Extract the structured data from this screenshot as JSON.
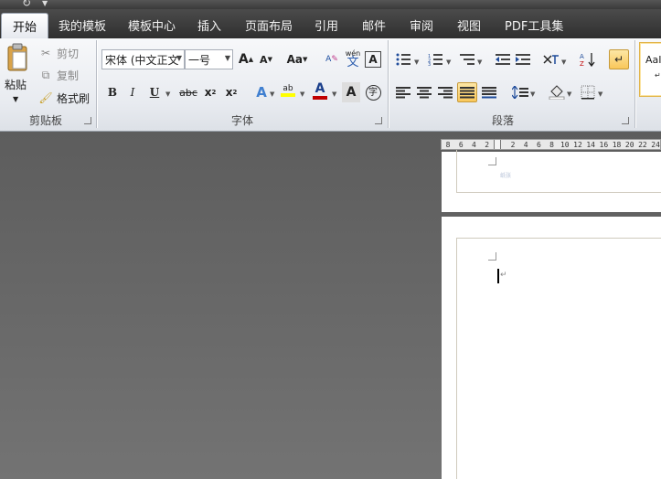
{
  "tabs": [
    "开始",
    "我的模板",
    "模板中心",
    "插入",
    "页面布局",
    "引用",
    "邮件",
    "审阅",
    "视图",
    "PDF工具集"
  ],
  "clipboard": {
    "group_label": "剪贴板",
    "paste": "粘贴",
    "cut": "剪切",
    "copy": "复制",
    "format_painter": "格式刷"
  },
  "font": {
    "group_label": "字体",
    "font_name": "宋体 (中文正文",
    "font_size": "一号",
    "grow": "A",
    "shrink": "A",
    "change_case": "Aa",
    "phonetic": "wén",
    "char_border": "A",
    "bold": "B",
    "italic": "I",
    "underline": "U",
    "strike": "abc",
    "subscript": "x",
    "superscript": "x",
    "text_effect": "A",
    "highlight": "ab",
    "font_color": "A",
    "char_shading": "A",
    "enclose": "字"
  },
  "paragraph": {
    "group_label": "段落"
  },
  "styles": {
    "preview": "AaI"
  },
  "document": {
    "page1_faint_text": "纸张"
  },
  "ruler": {
    "ticks": [
      "8",
      "6",
      "4",
      "2",
      "",
      "2",
      "4",
      "6",
      "8",
      "10",
      "12",
      "14",
      "16",
      "18",
      "20",
      "22",
      "24"
    ]
  },
  "colors": {
    "highlight": "#ffff00",
    "font_color": "#c00000",
    "text_effect": "#3f7fd0"
  }
}
